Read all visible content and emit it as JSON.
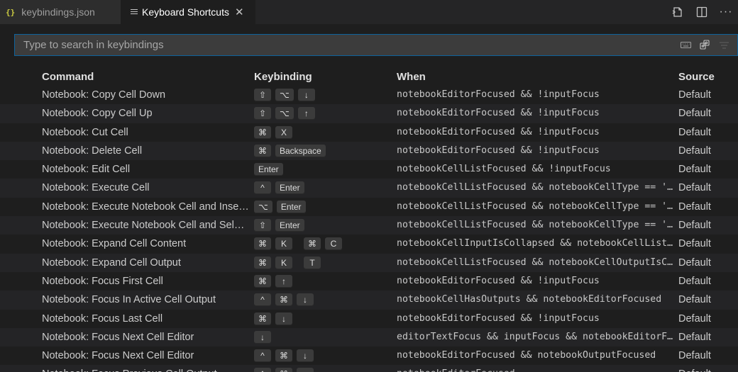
{
  "tabs": [
    {
      "icon": "{}",
      "label": "keybindings.json"
    },
    {
      "label": "Keyboard Shortcuts",
      "close": "✕"
    }
  ],
  "actions": {
    "more": "···"
  },
  "search": {
    "placeholder": "Type to search in keybindings",
    "value": ""
  },
  "columns": {
    "command": "Command",
    "keybinding": "Keybinding",
    "when": "When",
    "source": "Source"
  },
  "rows": [
    {
      "command": "Notebook: Copy Cell Down",
      "keys": [
        [
          "⇧",
          "⌥",
          "↓"
        ]
      ],
      "when": "notebookEditorFocused && !inputFocus",
      "source": "Default"
    },
    {
      "command": "Notebook: Copy Cell Up",
      "keys": [
        [
          "⇧",
          "⌥",
          "↑"
        ]
      ],
      "when": "notebookEditorFocused && !inputFocus",
      "source": "Default"
    },
    {
      "command": "Notebook: Cut Cell",
      "keys": [
        [
          "⌘",
          "X"
        ]
      ],
      "when": "notebookEditorFocused && !inputFocus",
      "source": "Default"
    },
    {
      "command": "Notebook: Delete Cell",
      "keys": [
        [
          "⌘",
          "Backspace"
        ]
      ],
      "when": "notebookEditorFocused && !inputFocus",
      "source": "Default"
    },
    {
      "command": "Notebook: Edit Cell",
      "keys": [
        [
          "Enter"
        ]
      ],
      "when": "notebookCellListFocused && !inputFocus",
      "source": "Default"
    },
    {
      "command": "Notebook: Execute Cell",
      "keys": [
        [
          "^",
          "Enter"
        ]
      ],
      "when": "notebookCellListFocused && notebookCellType == 'm…",
      "source": "Default"
    },
    {
      "command": "Notebook: Execute Notebook Cell and Inser…",
      "keys": [
        [
          "⌥",
          "Enter"
        ]
      ],
      "when": "notebookCellListFocused && notebookCellType == 'm…",
      "source": "Default"
    },
    {
      "command": "Notebook: Execute Notebook Cell and Sele…",
      "keys": [
        [
          "⇧",
          "Enter"
        ]
      ],
      "when": "notebookCellListFocused && notebookCellType == 'm…",
      "source": "Default"
    },
    {
      "command": "Notebook: Expand Cell Content",
      "keys": [
        [
          "⌘",
          "K"
        ],
        [
          "⌘",
          "C"
        ]
      ],
      "when": "notebookCellInputIsCollapsed && notebookCellListF…",
      "source": "Default"
    },
    {
      "command": "Notebook: Expand Cell Output",
      "keys": [
        [
          "⌘",
          "K"
        ],
        [
          "T"
        ]
      ],
      "when": "notebookCellListFocused && notebookCellOutputIsCo…",
      "source": "Default"
    },
    {
      "command": "Notebook: Focus First Cell",
      "keys": [
        [
          "⌘",
          "↑"
        ]
      ],
      "when": "notebookEditorFocused && !inputFocus",
      "source": "Default"
    },
    {
      "command": "Notebook: Focus In Active Cell Output",
      "keys": [
        [
          "^",
          "⌘",
          "↓"
        ]
      ],
      "when": "notebookCellHasOutputs && notebookEditorFocused",
      "source": "Default"
    },
    {
      "command": "Notebook: Focus Last Cell",
      "keys": [
        [
          "⌘",
          "↓"
        ]
      ],
      "when": "notebookEditorFocused && !inputFocus",
      "source": "Default"
    },
    {
      "command": "Notebook: Focus Next Cell Editor",
      "keys": [
        [
          "↓"
        ]
      ],
      "when": "editorTextFocus && inputFocus && notebookEditorFo…",
      "source": "Default"
    },
    {
      "command": "Notebook: Focus Next Cell Editor",
      "keys": [
        [
          "^",
          "⌘",
          "↓"
        ]
      ],
      "when": "notebookEditorFocused && notebookOutputFocused",
      "source": "Default"
    },
    {
      "command": "Notebook: Focus Previous Cell Output",
      "keys": [
        [
          "^",
          "⌘",
          "↑"
        ]
      ],
      "when": "notebookEditorFocused",
      "source": "Default"
    }
  ]
}
